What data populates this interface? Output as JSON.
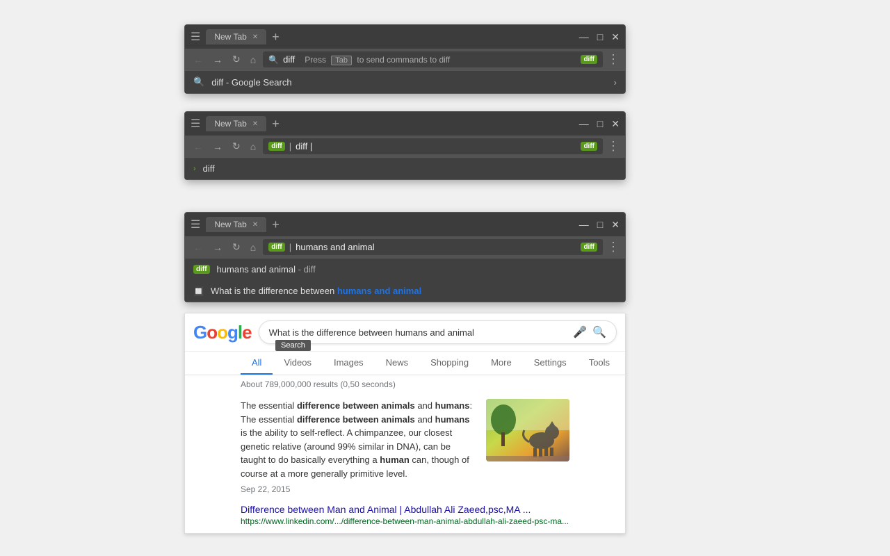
{
  "window1": {
    "tab_label": "New Tab",
    "address_bar_content": "diff",
    "press_tab_text": "Press",
    "tab_key": "Tab",
    "send_commands_text": "to send commands to diff",
    "diff_badge": "diff",
    "suggestion_text": "diff - Google Search",
    "suggestion_chevron": "›"
  },
  "window2": {
    "tab_label": "New Tab",
    "diff_badge_addr": "diff",
    "address_input": "diff |",
    "diff_badge_right": "diff",
    "suggestion_text": "diff",
    "suggestion_chevron": "›"
  },
  "window3": {
    "tab_label": "New Tab",
    "diff_badge_addr": "diff",
    "address_input": "humans and animal",
    "diff_badge_right": "diff",
    "suggestion1_badge": "diff",
    "suggestion1_text": "humans and animal",
    "suggestion1_suffix": "- diff",
    "suggestion2_text": "What is the difference between ",
    "suggestion2_bold": "humans and animal",
    "suggestion2_icon": "🔲"
  },
  "google": {
    "logo": {
      "g1": "G",
      "o1": "o",
      "o2": "o",
      "g2": "g",
      "l": "l",
      "e": "e"
    },
    "search_query": "What is the difference between humans and animal",
    "search_tooltip": "Search",
    "tabs": [
      "All",
      "Videos",
      "Images",
      "News",
      "Shopping",
      "More",
      "Settings",
      "Tools"
    ],
    "active_tab": "All",
    "results_info": "About 789,000,000 results (0,50 seconds)",
    "result_snippet": "The essential difference between animals and humans: The essential difference between animals and humans is the ability to self-reflect. A chimpanzee, our closest genetic relative (around 99% similar in DNA), can be taught to do basically everything a human can, though of course at a more generally primitive level.",
    "result_date": "Sep 22, 2015",
    "result_link_text": "Difference between Man and Animal | Abdullah Ali Zaeed,psc,MA ...",
    "result_url": "https://www.linkedin.com/.../difference-between-man-animal-abdullah-ali-zaeed-psc-ma..."
  },
  "window_controls": {
    "minimize": "—",
    "maximize": "□",
    "close": "✕"
  },
  "nav": {
    "back": "←",
    "forward": "→",
    "refresh": "↻",
    "home": "⌂"
  }
}
